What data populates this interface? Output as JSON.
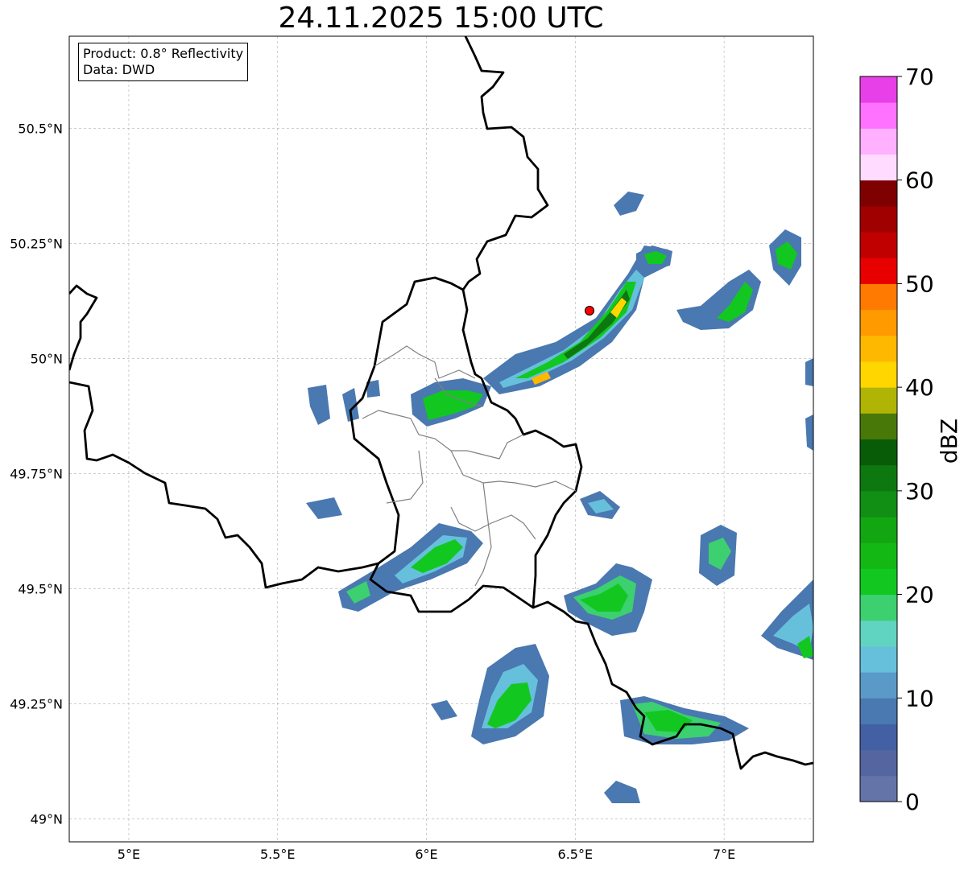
{
  "title": "24.11.2025 15:00 UTC",
  "info": {
    "product": "Product: 0.8° Reflectivity",
    "source": "Data: DWD"
  },
  "map": {
    "lon_range": [
      4.8,
      7.3
    ],
    "lat_range": [
      48.95,
      50.7
    ],
    "grid": true,
    "lon_ticks": [
      "5°E",
      "5.5°E",
      "6°E",
      "6.5°E",
      "7°E"
    ],
    "lat_ticks": [
      "50.5°N",
      "50.25°N",
      "50°N",
      "49.75°N",
      "49.5°N",
      "49.25°N",
      "49°N"
    ],
    "radar_site_marker": {
      "lon": 6.55,
      "lat": 50.11,
      "color": "#ff0000"
    }
  },
  "colorbar": {
    "label": "dBZ",
    "tick_labels": [
      "0",
      "10",
      "20",
      "30",
      "40",
      "50",
      "60",
      "70"
    ],
    "colors": [
      "#6574a8",
      "#5465a0",
      "#4360a4",
      "#4a78b0",
      "#5a9ac8",
      "#66c0dc",
      "#60d4c0",
      "#3cd070",
      "#12c820",
      "#14b814",
      "#12a612",
      "#118e14",
      "#0e7810",
      "#085c08",
      "#487808",
      "#b0b404",
      "#ffd600",
      "#ffb800",
      "#ff9a00",
      "#ff7a00",
      "#e80000",
      "#c00000",
      "#a00000",
      "#7e0000",
      "#ffdcff",
      "#ffb0ff",
      "#ff72ff",
      "#e840e8"
    ]
  }
}
